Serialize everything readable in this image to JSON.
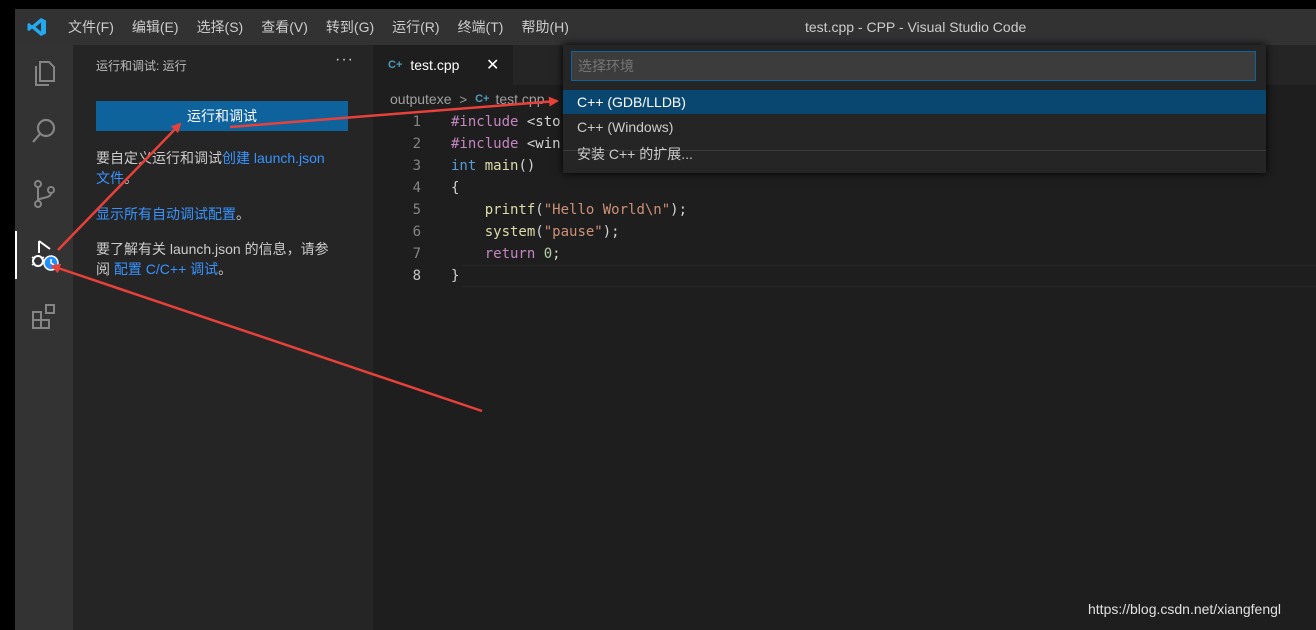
{
  "titlebar": {
    "menu": [
      "文件(F)",
      "编辑(E)",
      "选择(S)",
      "查看(V)",
      "转到(G)",
      "运行(R)",
      "终端(T)",
      "帮助(H)"
    ],
    "window_title": "test.cpp - CPP - Visual Studio Code"
  },
  "activity_bar": {
    "items": [
      "explorer-icon",
      "search-icon",
      "source-control-icon",
      "run-debug-icon",
      "extensions-icon"
    ],
    "active": "run-debug-icon"
  },
  "sidebar": {
    "title": "运行和调试: 运行",
    "more": "···",
    "run_button": "运行和调试",
    "customize_pre": "要自定义运行和调试",
    "customize_link": "创建 launch.json",
    "customize_link2": "文件",
    "customize_post": "。",
    "show_all_link": "显示所有自动调试配置",
    "show_all_post": "。",
    "learn_pre": "要了解有关 launch.json 的信息，请参",
    "learn_pre2": "阅 ",
    "learn_link": "配置 C/C++ 调试",
    "learn_post": "。"
  },
  "editor": {
    "tab": {
      "icon": "C+",
      "label": "test.cpp",
      "close": "✕"
    },
    "breadcrumb": {
      "folder": "outputexe",
      "sep": ">",
      "icon": "C+",
      "file": "test.cpp"
    },
    "lines": [
      {
        "n": "1",
        "parts": [
          [
            "kw-pre",
            "#include"
          ],
          [
            "",
            " <sto"
          ]
        ]
      },
      {
        "n": "2",
        "parts": [
          [
            "kw-pre",
            "#include"
          ],
          [
            "",
            " <win"
          ]
        ]
      },
      {
        "n": "3",
        "parts": [
          [
            "kw",
            "int"
          ],
          [
            "",
            " "
          ],
          [
            "fn",
            "main"
          ],
          [
            "",
            "()"
          ]
        ]
      },
      {
        "n": "4",
        "parts": [
          [
            "",
            "{"
          ]
        ]
      },
      {
        "n": "5",
        "parts": [
          [
            "",
            "    "
          ],
          [
            "fn",
            "printf"
          ],
          [
            "",
            "("
          ],
          [
            "str",
            "\"Hello World\\n\""
          ],
          [
            "",
            ");"
          ]
        ]
      },
      {
        "n": "6",
        "parts": [
          [
            "",
            "    "
          ],
          [
            "fn",
            "system"
          ],
          [
            "",
            "("
          ],
          [
            "str",
            "\"pause\""
          ],
          [
            "",
            ");"
          ]
        ]
      },
      {
        "n": "7",
        "parts": [
          [
            "",
            "    "
          ],
          [
            "kw-pre",
            "return"
          ],
          [
            "",
            " "
          ],
          [
            "num",
            "0"
          ],
          [
            "",
            ";"
          ]
        ]
      },
      {
        "n": "8",
        "parts": [
          [
            "",
            "}"
          ]
        ]
      }
    ],
    "current_line": "8"
  },
  "quick_pick": {
    "placeholder": "选择环境",
    "items": [
      "C++ (GDB/LLDB)",
      "C++ (Windows)",
      "安装 C++ 的扩展..."
    ],
    "selected": 0
  },
  "watermark": "https://blog.csdn.net/xiangfengl",
  "colors": {
    "accent": "#0e639c",
    "annotation_arrow": "#e8413a"
  }
}
